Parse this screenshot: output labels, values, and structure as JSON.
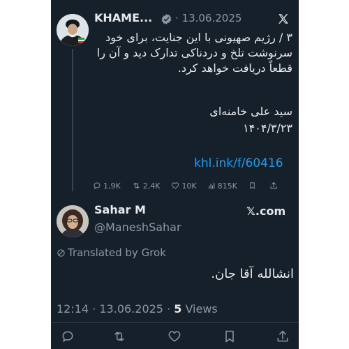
{
  "tweet1": {
    "name": "KHAME...",
    "date": "· 13.06.2025",
    "text": "۳ / رژیم صهیونی با این جنایت، برای خود سرنوشت تلخ و دردناکی تدارک دید و آن را قطعاً دریافت خواهد کرد.",
    "signature_name": "سید علی خامنه‌ای",
    "signature_date": "۱۴۰۴/۳/۲۳",
    "link": "khl.ink/f/60416",
    "stats": {
      "replies": "1,9K",
      "reposts": "2,4K",
      "likes": "10K",
      "views": "815K"
    }
  },
  "tweet2": {
    "name": "Sahar M",
    "handle": "@ManeshSahar",
    "site": "𝕏.com",
    "translated_label": "Translated by Grok",
    "text": "انشالله آقا جان.",
    "time_date": "12:14 · 13.06.2025 · ",
    "views_count": "5",
    "views_label": " Views"
  },
  "colors": {
    "background": "#15202b",
    "text": "#e7e9ea",
    "muted": "#8b98a5",
    "link": "#1d9bf0",
    "verified": "#8b98a5"
  },
  "icons": [
    "verified-badge-icon",
    "x-logo-icon",
    "reply-icon",
    "repost-icon",
    "like-icon",
    "views-icon",
    "bookmark-icon",
    "share-icon",
    "translate-icon"
  ]
}
